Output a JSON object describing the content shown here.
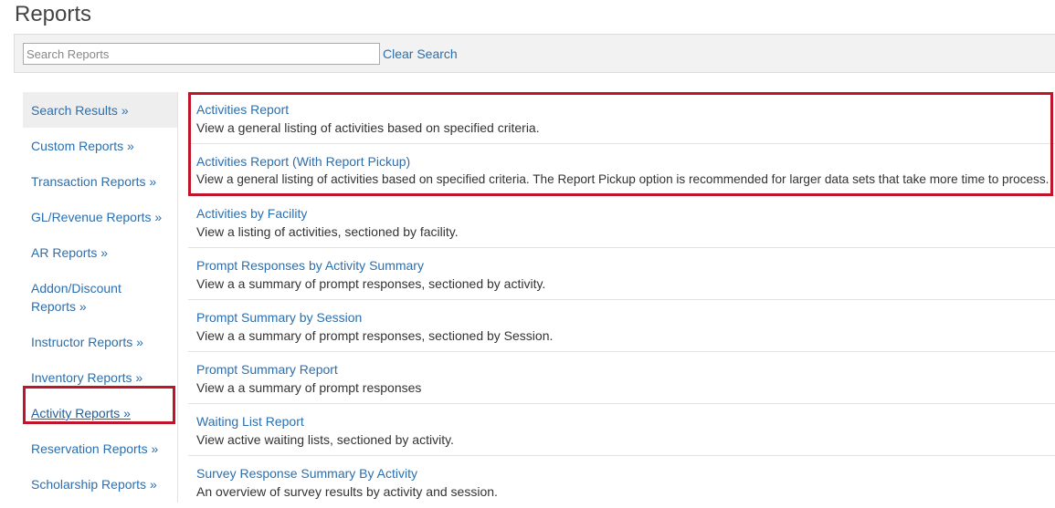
{
  "page": {
    "title": "Reports"
  },
  "search": {
    "placeholder": "Search Reports",
    "value": "",
    "clear_label": "Clear Search"
  },
  "sidebar": {
    "items": [
      {
        "label": "Search Results »"
      },
      {
        "label": "Custom Reports »"
      },
      {
        "label": "Transaction Reports »"
      },
      {
        "label": "GL/Revenue Reports »"
      },
      {
        "label": "AR Reports »"
      },
      {
        "label": "Addon/Discount Reports »"
      },
      {
        "label": "Instructor Reports »"
      },
      {
        "label": "Inventory Reports »"
      },
      {
        "label": "Activity Reports »"
      },
      {
        "label": "Reservation Reports »"
      },
      {
        "label": "Scholarship Reports »"
      }
    ]
  },
  "reports": [
    {
      "title": "Activities Report",
      "description": "View a general listing of activities based on specified criteria."
    },
    {
      "title": "Activities Report (With Report Pickup)",
      "description": "View a general listing of activities based on specified criteria. The Report Pickup option is recommended for larger data sets that take more time to process."
    },
    {
      "title": "Activities by Facility",
      "description": "View a listing of activities, sectioned by facility."
    },
    {
      "title": "Prompt Responses by Activity Summary",
      "description": "View a a summary of prompt responses, sectioned by activity."
    },
    {
      "title": "Prompt Summary by Session",
      "description": "View a a summary of prompt responses, sectioned by Session."
    },
    {
      "title": "Prompt Summary Report",
      "description": "View a a summary of prompt responses"
    },
    {
      "title": "Waiting List Report",
      "description": "View active waiting lists, sectioned by activity."
    },
    {
      "title": "Survey Response Summary By Activity",
      "description": "An overview of survey results by activity and session."
    }
  ],
  "colors": {
    "link": "#2a6fb0",
    "highlight": "#c0142a"
  }
}
